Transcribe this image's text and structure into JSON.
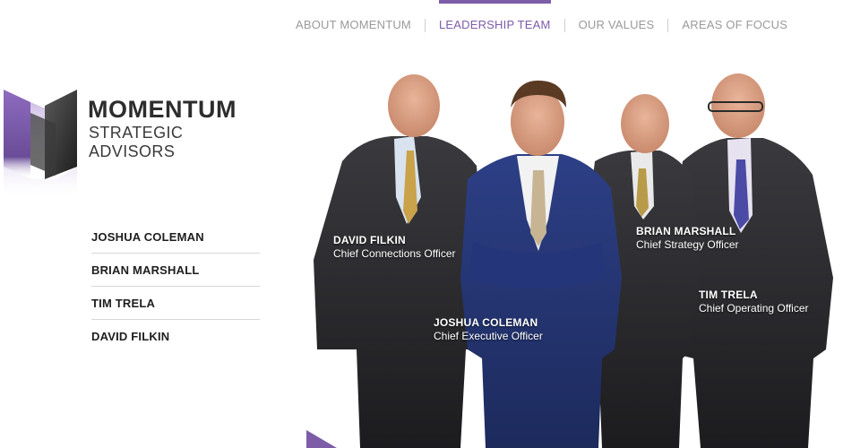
{
  "nav": {
    "items": [
      {
        "label": "ABOUT MOMENTUM"
      },
      {
        "label": "LEADERSHIP TEAM"
      },
      {
        "label": "OUR VALUES"
      },
      {
        "label": "AREAS OF FOCUS"
      }
    ],
    "active": "LEADERSHIP TEAM"
  },
  "brand": {
    "name": "MOMENTUM",
    "tagline": "STRATEGIC ADVISORS"
  },
  "sidebar": {
    "items": [
      {
        "label": "JOSHUA COLEMAN"
      },
      {
        "label": "BRIAN MARSHALL"
      },
      {
        "label": "TIM TRELA"
      },
      {
        "label": "DAVID FILKIN"
      }
    ]
  },
  "team": [
    {
      "name": "DAVID FILKIN",
      "title": "Chief Connections Officer"
    },
    {
      "name": "BRIAN MARSHALL",
      "title": "Chief Strategy Officer"
    },
    {
      "name": "TIM TRELA",
      "title": "Chief Operating Officer"
    },
    {
      "name": "JOSHUA COLEMAN",
      "title": "Chief Executive Officer"
    }
  ],
  "colors": {
    "accent": "#7d5ca8",
    "nav_text": "#9a9a9a",
    "text": "#1e1e1e"
  }
}
